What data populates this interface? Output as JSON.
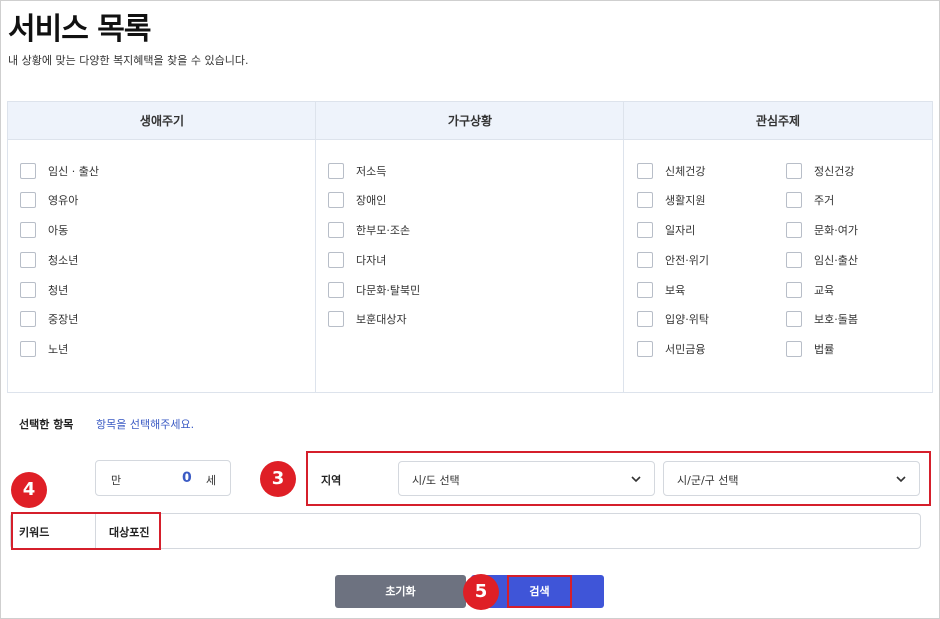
{
  "page": {
    "title": "서비스 목록",
    "subtitle": "내 상황에 맞는 다양한 복지혜택을 찾을 수 있습니다."
  },
  "filters": {
    "life_cycle": {
      "header": "생애주기",
      "items": [
        "임신 · 출산",
        "영유아",
        "아동",
        "청소년",
        "청년",
        "중장년",
        "노년"
      ]
    },
    "household": {
      "header": "가구상황",
      "items": [
        "저소득",
        "장애인",
        "한부모·조손",
        "다자녀",
        "다문화·탈북민",
        "보훈대상자"
      ]
    },
    "interest": {
      "header": "관심주제",
      "left_items": [
        "신체건강",
        "생활지원",
        "일자리",
        "안전·위기",
        "보육",
        "입양·위탁",
        "서민금융"
      ],
      "right_items": [
        "정신건강",
        "주거",
        "문화·여가",
        "임신·출산",
        "교육",
        "보호·돌봄",
        "법률"
      ]
    }
  },
  "selected": {
    "label": "선택한 항목",
    "placeholder": "항목을 선택해주세요."
  },
  "age": {
    "prefix": "만",
    "value": "0",
    "suffix": "세"
  },
  "region": {
    "label": "지역",
    "sido_selected": "시/도 선택",
    "sigungu_selected": "시/군/구 선택"
  },
  "keyword": {
    "label": "키워드",
    "value": "대상포진"
  },
  "buttons": {
    "reset": "초기화",
    "search": "검색"
  },
  "annotations": {
    "badge_region": "3",
    "badge_keyword": "4",
    "badge_search": "5"
  },
  "colors": {
    "accent_blue": "#3f55d8",
    "reset_gray": "#6d7280",
    "highlight_red": "#d51f2b",
    "header_bg": "#eef3fb"
  }
}
